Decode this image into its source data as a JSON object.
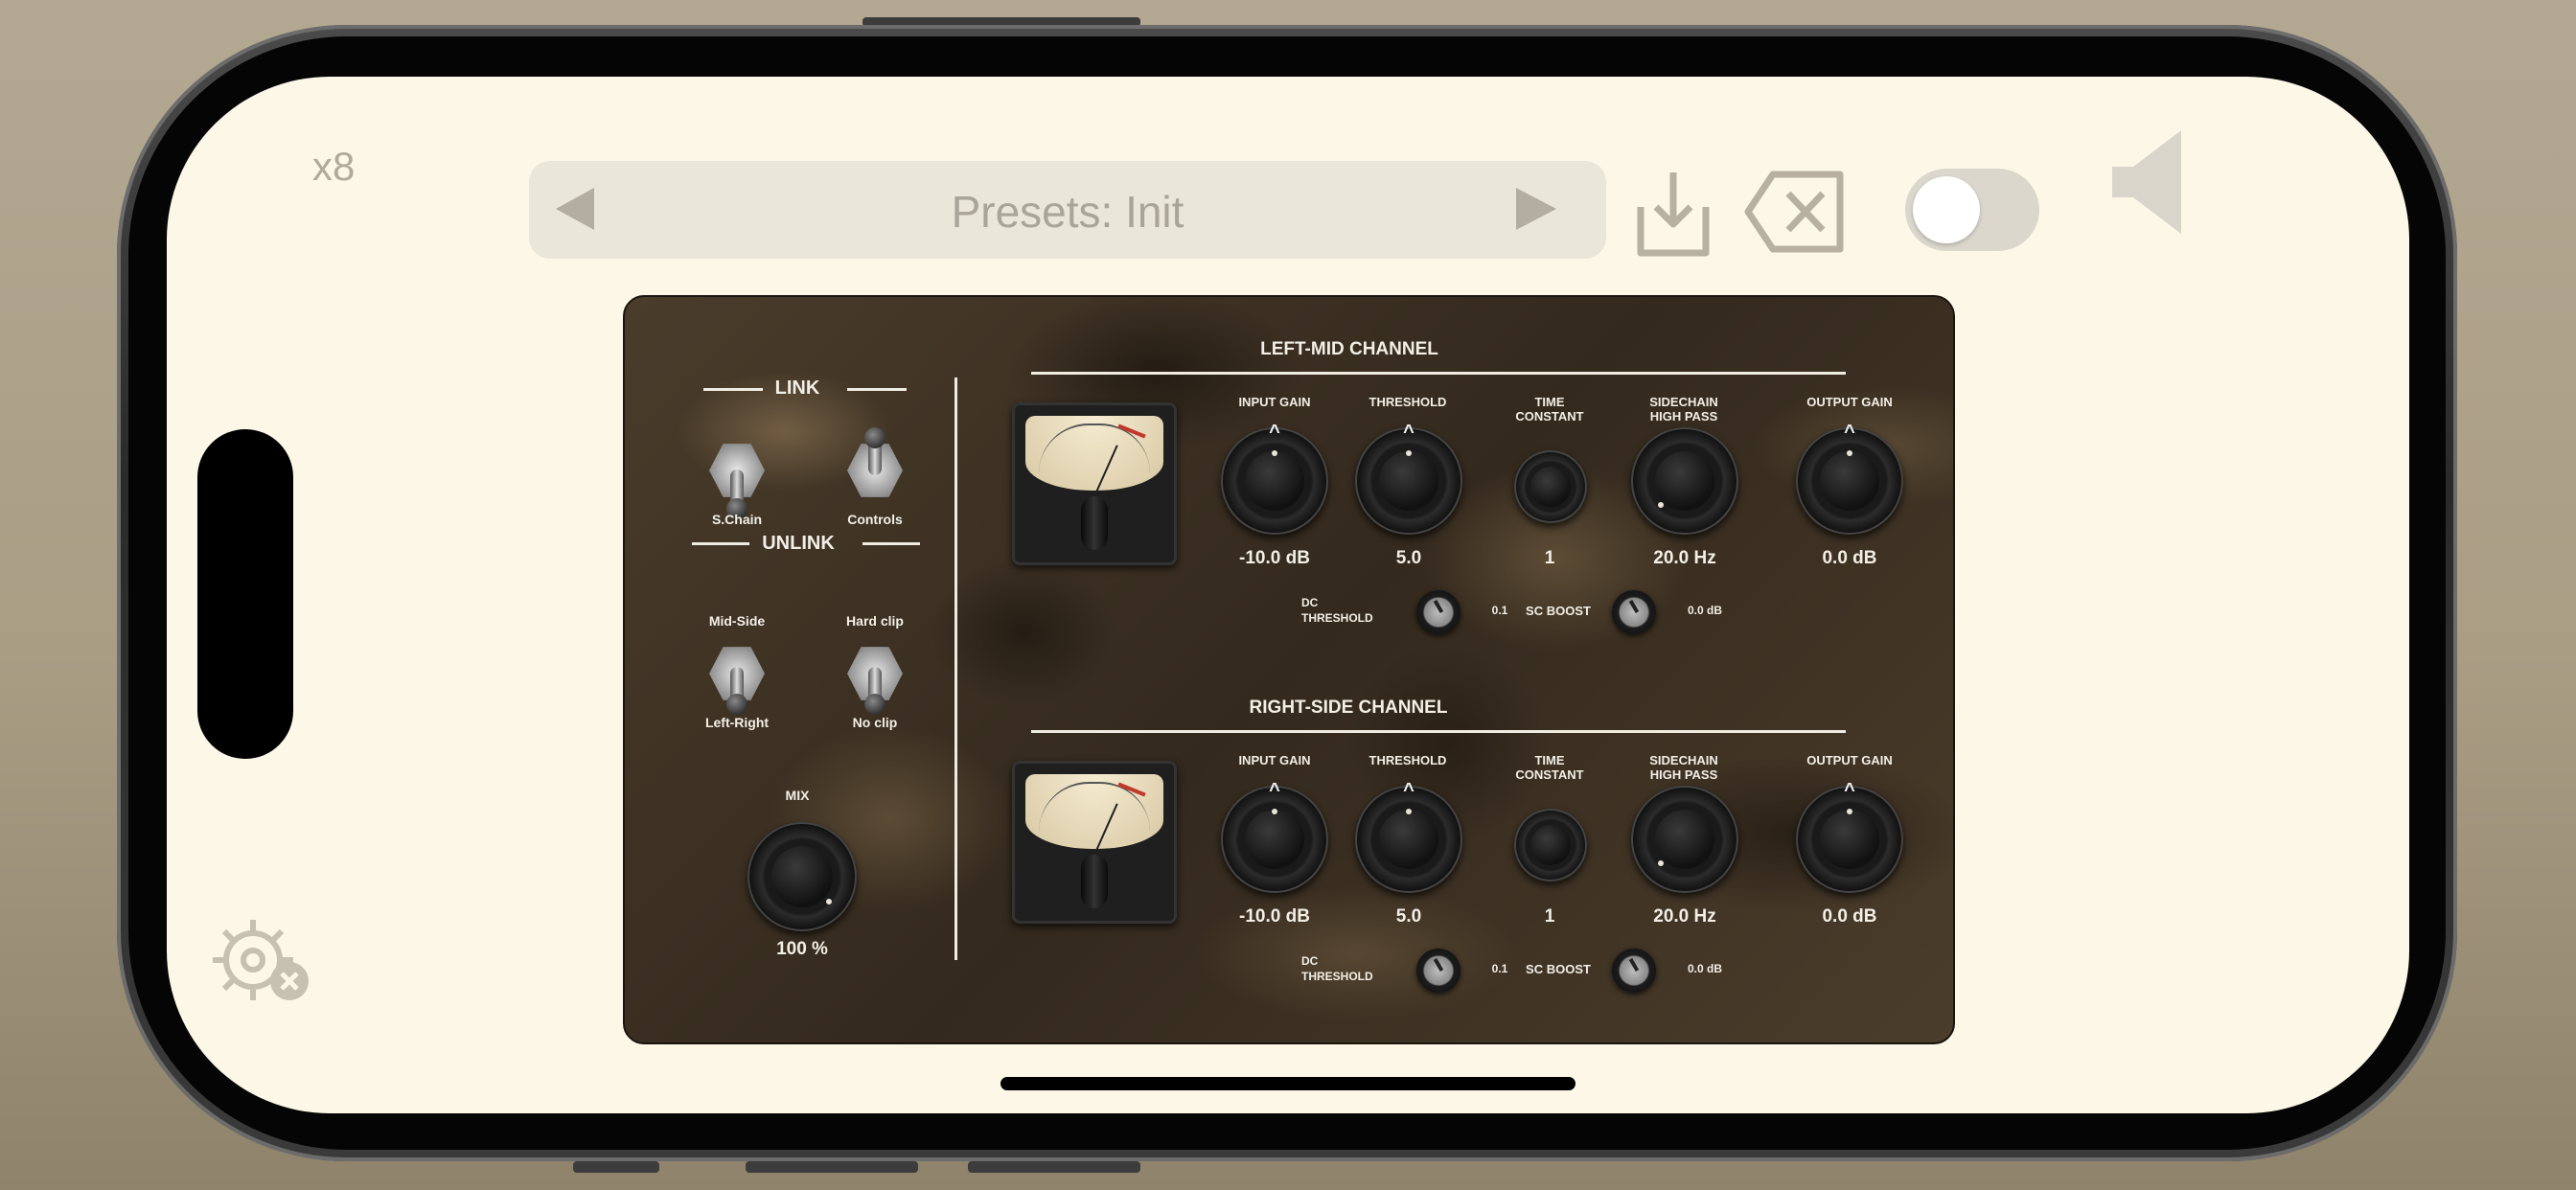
{
  "app": {
    "multiplier": "x8",
    "presets_label": "Presets: Init",
    "bypass_enabled": false
  },
  "link_section": {
    "link_title": "LINK",
    "unlink_title": "UNLINK",
    "schain_label": "S.Chain",
    "controls_label": "Controls",
    "midside_label": "Mid-Side",
    "leftright_label": "Left-Right",
    "hardclip_label": "Hard clip",
    "noclip_label": "No clip",
    "mix_label": "MIX",
    "mix_value": "100 %"
  },
  "channels": [
    {
      "title": "LEFT-MID CHANNEL",
      "input_gain_label": "INPUT GAIN",
      "input_gain_value": "-10.0 dB",
      "threshold_label": "THRESHOLD",
      "threshold_value": "5.0",
      "time_constant_label_1": "TIME",
      "time_constant_label_2": "CONSTANT",
      "time_constant_value": "1",
      "sidechain_label_1": "SIDECHAIN",
      "sidechain_label_2": "HIGH PASS",
      "sidechain_value": "20.0 Hz",
      "output_gain_label": "OUTPUT GAIN",
      "output_gain_value": "0.0 dB",
      "dc_threshold_label_1": "DC",
      "dc_threshold_label_2": "THRESHOLD",
      "dc_threshold_value": "0.1",
      "sc_boost_label": "SC BOOST",
      "sc_boost_value": "0.0 dB"
    },
    {
      "title": "RIGHT-SIDE CHANNEL",
      "input_gain_label": "INPUT GAIN",
      "input_gain_value": "-10.0 dB",
      "threshold_label": "THRESHOLD",
      "threshold_value": "5.0",
      "time_constant_label_1": "TIME",
      "time_constant_label_2": "CONSTANT",
      "time_constant_value": "1",
      "sidechain_label_1": "SIDECHAIN",
      "sidechain_label_2": "HIGH PASS",
      "sidechain_value": "20.0 Hz",
      "output_gain_label": "OUTPUT GAIN",
      "output_gain_value": "0.0 dB",
      "dc_threshold_label_1": "DC",
      "dc_threshold_label_2": "THRESHOLD",
      "dc_threshold_value": "0.1",
      "sc_boost_label": "SC BOOST",
      "sc_boost_value": "0.0 dB"
    }
  ],
  "icons": {
    "prev": "arrow-left-icon",
    "next": "arrow-right-icon",
    "save": "download-icon",
    "delete": "backspace-icon",
    "speaker": "speaker-icon",
    "settings": "gear-close-icon"
  }
}
